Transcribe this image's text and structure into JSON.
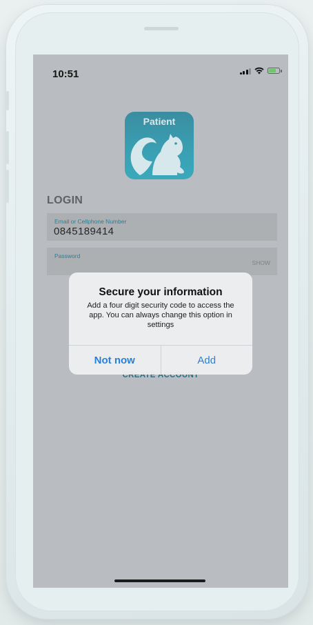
{
  "status_bar": {
    "time": "10:51",
    "icons": [
      "signal-icon",
      "wifi-icon",
      "battery-icon"
    ]
  },
  "app_logo": {
    "label": "Patient",
    "icon": "squirrel-icon",
    "color": "#3aa9bb"
  },
  "login": {
    "heading": "LOGIN",
    "email_field": {
      "label": "Email or Cellphone Number",
      "value": "0845189414"
    },
    "password_field": {
      "label": "Password",
      "value": "",
      "show_label": "SHOW"
    },
    "create_account_label": "CREATE ACCOUNT"
  },
  "dialog": {
    "title": "Secure your information",
    "message": "Add a four digit security code to access the app. You can always change this option in settings",
    "cancel_label": "Not now",
    "confirm_label": "Add",
    "accent_color": "#2a7fd6"
  }
}
